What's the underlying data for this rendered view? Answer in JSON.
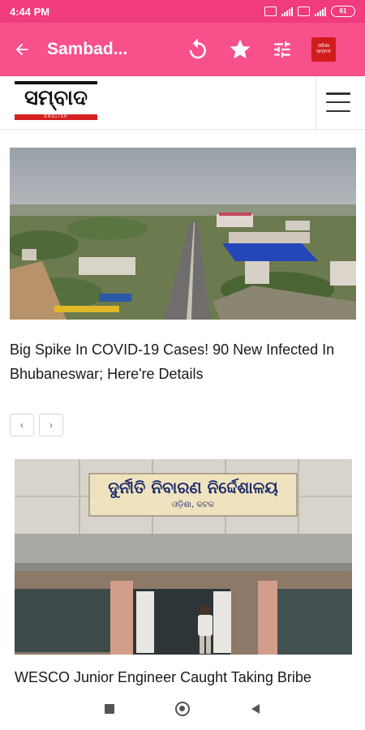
{
  "status_bar": {
    "time": "4:44 PM",
    "battery": "61"
  },
  "app_bar": {
    "title": "Sambad...",
    "back_icon": "arrow-left-icon",
    "refresh_icon": "refresh-icon",
    "favorite_icon": "star-icon",
    "settings_icon": "sliders-icon",
    "badge_text": "ଓଡ଼ିଶା ସମ୍ବାଦ"
  },
  "site_header": {
    "logo_top": "SAMBAD",
    "logo_text": "ସମ୍ବାଦ",
    "logo_bottom": "ENGLISH",
    "menu_icon": "hamburger-menu-icon"
  },
  "articles": [
    {
      "title": "Big Spike In COVID-19 Cases! 90 New Infected In Bhubaneswar; Here're Details"
    },
    {
      "title": "WESCO Junior Engineer Caught Taking Bribe",
      "sign_text": "ଦୁର୍ନୀତି ନିବାରଣ ନିର୍ଦ୍ଦେଶାଳୟ",
      "sign_subtext": "ଓଡ଼ିଶା, କଟକ"
    }
  ],
  "pager": {
    "prev": "‹",
    "next": "›"
  },
  "colors": {
    "status_bar": "#f03b7c",
    "app_bar": "#f7508a",
    "logo_red": "#d42020"
  }
}
